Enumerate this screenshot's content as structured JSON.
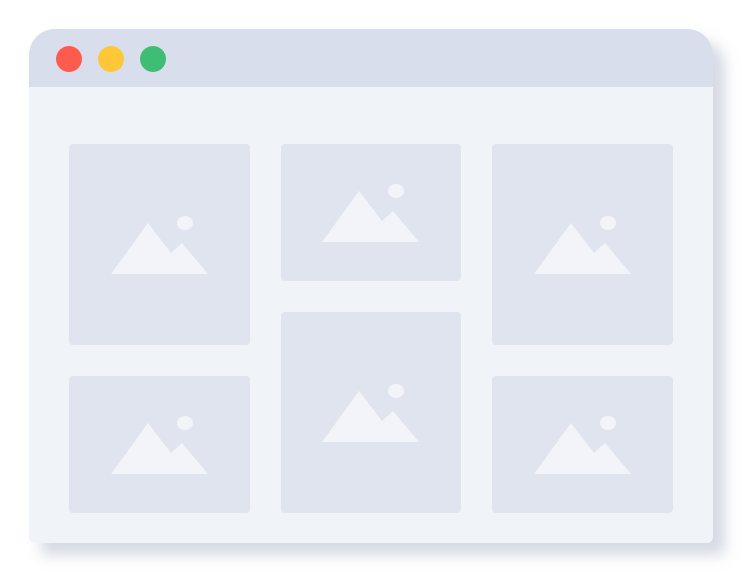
{
  "window": {
    "controls": [
      {
        "name": "close",
        "color": "#fd5b4e"
      },
      {
        "name": "minimize",
        "color": "#fec737"
      },
      {
        "name": "maximize",
        "color": "#3dbe74"
      }
    ]
  },
  "gallery": {
    "items": [
      {
        "icon": "image-icon"
      },
      {
        "icon": "image-icon"
      },
      {
        "icon": "image-icon"
      },
      {
        "icon": "image-icon"
      },
      {
        "icon": "image-icon"
      },
      {
        "icon": "image-icon"
      }
    ]
  },
  "colors": {
    "titlebar": "#d8deec",
    "window_background": "#f0f3f8",
    "tile": "#e0e4ef",
    "placeholder_icon": "#f2f4f9"
  }
}
